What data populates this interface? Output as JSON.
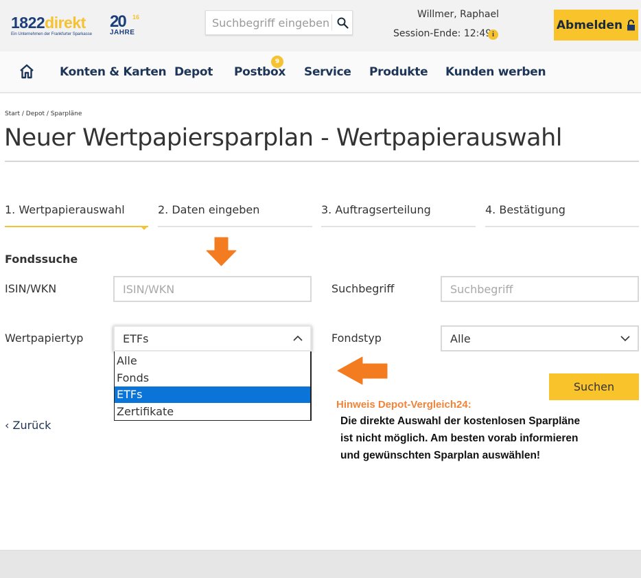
{
  "brand": {
    "logo_number": "1822",
    "logo_text": "direkt",
    "logo_tagline": "Ein Unternehmen der Frankfurter Sparkasse",
    "anniversary_big": "20",
    "anniversary_sup": "16",
    "anniversary_label": "JAHRE",
    "colors": {
      "navy": "#1c3f7c",
      "yellow": "#f5c231",
      "accent_orange": "#f0843a",
      "select_blue": "#0a74d8"
    }
  },
  "header": {
    "search_placeholder": "Suchbegriff eingeben",
    "search_icon": "search-icon",
    "user_name": "Willmer, Raphael",
    "session_label": "Session-Ende: 12:49",
    "info_icon": "i",
    "logout_label": "Abmelden",
    "logout_icon": "lock-icon"
  },
  "nav": {
    "home_icon": "home-icon",
    "items": [
      {
        "label": "Konten & Karten"
      },
      {
        "label": "Depot"
      },
      {
        "label": "Postbox",
        "badge": "9"
      },
      {
        "label": "Service"
      },
      {
        "label": "Produkte"
      },
      {
        "label": "Kunden werben"
      }
    ]
  },
  "breadcrumb": {
    "items": [
      "Start",
      "Depot",
      "Sparpläne"
    ],
    "separator": " / "
  },
  "page": {
    "title": "Neuer Wertpapiersparplan - Wertpapierauswahl"
  },
  "steps": [
    {
      "label": "1. Wertpapierauswahl",
      "active": true
    },
    {
      "label": "2. Daten eingeben",
      "active": false
    },
    {
      "label": "3. Auftragserteilung",
      "active": false
    },
    {
      "label": "4. Bestätigung",
      "active": false
    }
  ],
  "form": {
    "section_title": "Fondssuche",
    "isin_label": "ISIN/WKN",
    "isin_placeholder": "ISIN/WKN",
    "isin_value": "",
    "term_label": "Suchbegriff",
    "term_placeholder": "Suchbegriff",
    "term_value": "",
    "type_label": "Wertpapiertyp",
    "type_value": "ETFs",
    "type_options": [
      "Alle",
      "Fonds",
      "ETFs",
      "Zertifikate"
    ],
    "type_selected_index": 2,
    "fund_type_label": "Fondstyp",
    "fund_type_value": "Alle",
    "search_button": "Suchen",
    "back_link": "‹ Zurück"
  },
  "annotation": {
    "title": "Hinweis Depot-Vergleich24:",
    "lines": [
      "Die direkte Auswahl der kostenlosen Sparpläne",
      "ist nicht möglich. Am besten vorab informieren",
      "und gewünschten Sparplan auswählen!"
    ]
  }
}
